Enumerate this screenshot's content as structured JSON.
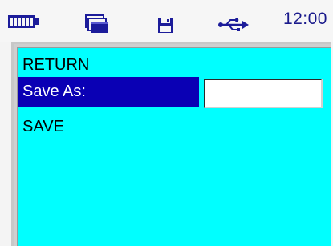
{
  "status_bar": {
    "icons": [
      "battery-icon",
      "windows-icon",
      "save-icon",
      "usb-icon"
    ],
    "time": "12:00"
  },
  "menu": {
    "items": [
      {
        "label": "RETURN"
      },
      {
        "label": "Save As:",
        "selected": true
      },
      {
        "label": "SAVE"
      }
    ]
  },
  "filename_input": {
    "value": "",
    "placeholder": ""
  },
  "colors": {
    "panel_background": "#00ffff",
    "selection_background": "#0a00b4",
    "selection_text": "#ffffff",
    "clock_text": "#1a1a8c",
    "icon_color": "#1c1c9a"
  }
}
